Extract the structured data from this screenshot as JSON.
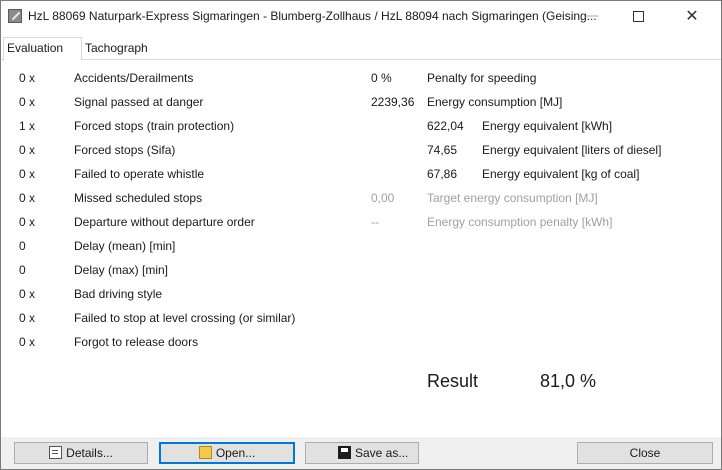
{
  "window": {
    "title": "HzL 88069 Naturpark-Express Sigmaringen - Blumberg-Zollhaus / HzL 88094 nach Sigmaringen (Geising...",
    "minimize_glyph": "—",
    "close_glyph": "✕"
  },
  "tabs": [
    {
      "label": "Evaluation",
      "active": true
    },
    {
      "label": "Tachograph",
      "active": false
    }
  ],
  "left_rows": [
    {
      "count": "0 x",
      "label": "Accidents/Derailments"
    },
    {
      "count": "0 x",
      "label": "Signal passed at danger"
    },
    {
      "count": "1 x",
      "label": "Forced stops (train protection)"
    },
    {
      "count": "0 x",
      "label": "Forced stops (Sifa)"
    },
    {
      "count": "0 x",
      "label": "Failed to operate whistle"
    },
    {
      "count": "0 x",
      "label": "Missed scheduled stops"
    },
    {
      "count": "0 x",
      "label": "Departure without departure order"
    },
    {
      "count": "0",
      "label": "Delay (mean) [min]"
    },
    {
      "count": "0",
      "label": "Delay (max) [min]"
    },
    {
      "count": "0 x",
      "label": "Bad driving style"
    },
    {
      "count": "0 x",
      "label": "Failed to stop at level crossing (or similar)"
    },
    {
      "count": "0 x",
      "label": "Forgot to release doors"
    }
  ],
  "right_rows": {
    "speeding": {
      "value": "0 %",
      "label": "Penalty for speeding"
    },
    "energy": {
      "value": "2239,36",
      "label": "Energy consumption [MJ]"
    },
    "kwh": {
      "value": "622,04",
      "label": "Energy equivalent [kWh]"
    },
    "diesel": {
      "value": "74,65",
      "label": "Energy equivalent [liters of diesel]"
    },
    "coal": {
      "value": "67,86",
      "label": "Energy equivalent [kg of coal]"
    },
    "target": {
      "value": "0,00",
      "label": "Target energy consumption [MJ]"
    },
    "penalty": {
      "value": "--",
      "label": "Energy consumption penalty [kWh]"
    }
  },
  "result": {
    "label": "Result",
    "value": "81,0 %"
  },
  "buttons": {
    "details": "Details...",
    "open": "Open...",
    "save": "Save as...",
    "close": "Close"
  },
  "colors": {
    "focus_border": "#0078d7",
    "disabled_text": "#a0a0a0"
  }
}
